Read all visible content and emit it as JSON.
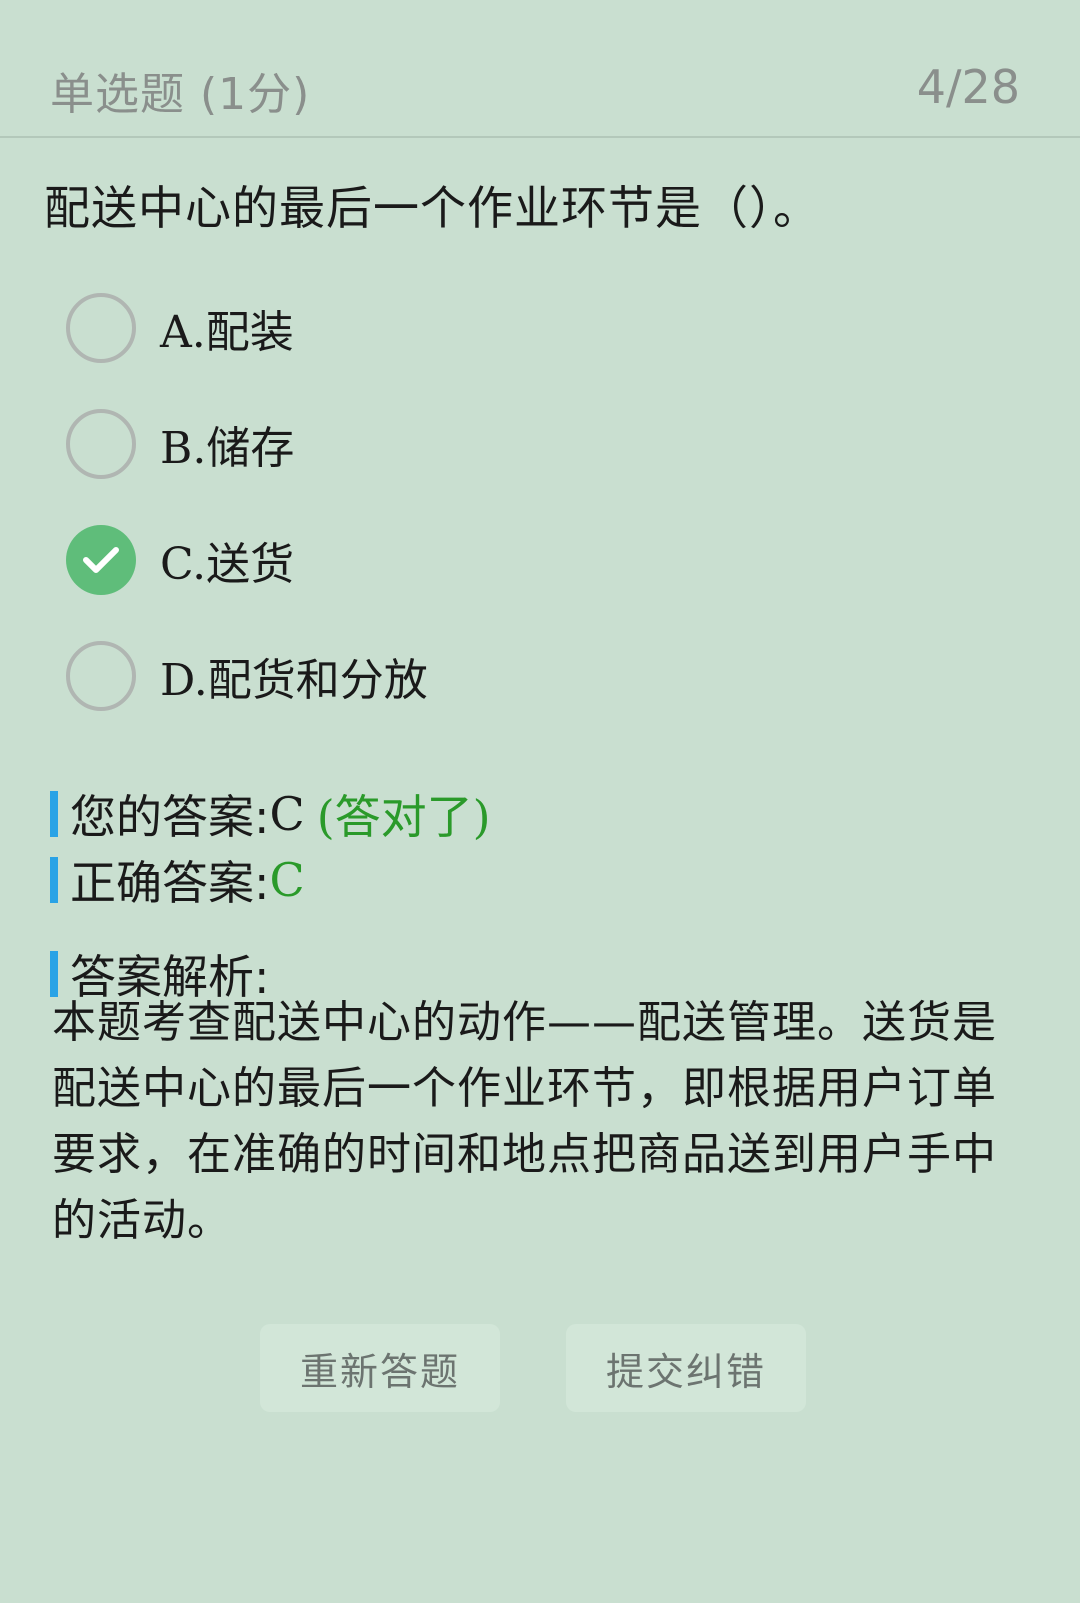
{
  "header": {
    "question_type": "单选题 (1分)",
    "progress": "4/28"
  },
  "question": {
    "text": "配送中心的最后一个作业环节是（）。",
    "options": [
      {
        "label": "A.配装",
        "selected": false
      },
      {
        "label": "B.储存",
        "selected": false
      },
      {
        "label": "C.送货",
        "selected": true
      },
      {
        "label": "D.配货和分放",
        "selected": false
      }
    ]
  },
  "result": {
    "your_answer_label": "您的答案:",
    "your_answer_value": "C",
    "verdict": "(答对了)",
    "correct_answer_label": "正确答案:",
    "correct_answer_value": "C"
  },
  "analysis": {
    "heading": "答案解析:",
    "text": "本题考查配送中心的动作——配送管理。送货是配送中心的最后一个作业环节，即根据用户订单要求，在准确的时间和地点把商品送到用户手中的活动。"
  },
  "buttons": {
    "retry_label": "重新答题",
    "report_label": "提交纠错"
  },
  "colors": {
    "background": "#c9dfd0",
    "check_green": "#5fbd7a",
    "correct_text_green": "#2a9a2a",
    "accent_bar_blue": "#2aa3e6"
  },
  "icons": {
    "selected_option": "checkmark-icon"
  }
}
